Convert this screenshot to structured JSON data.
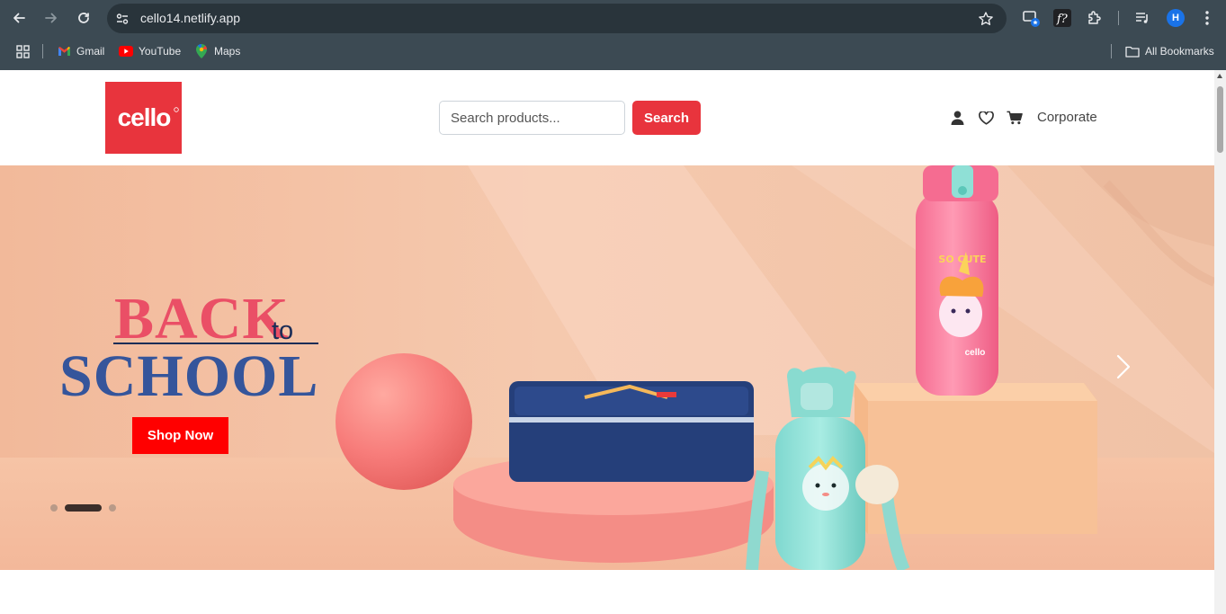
{
  "browser": {
    "url": "cello14.netlify.app",
    "bookmarks": [
      {
        "label": "Gmail",
        "icon": "gmail-icon"
      },
      {
        "label": "YouTube",
        "icon": "youtube-icon"
      },
      {
        "label": "Maps",
        "icon": "maps-icon"
      }
    ],
    "all_bookmarks_label": "All Bookmarks",
    "profile_initial": "H"
  },
  "header": {
    "logo_text": "cello",
    "search": {
      "placeholder": "Search products...",
      "value": "",
      "button_label": "Search"
    },
    "icons": [
      "user-icon",
      "heart-icon",
      "cart-icon"
    ],
    "corporate_label": "Corporate"
  },
  "hero": {
    "headline_line1": "BACK",
    "headline_to": "to",
    "headline_line2": "SCHOOL",
    "cta_label": "Shop Now",
    "bottle_text": "SO CUTE",
    "bottle_brand": "cello",
    "slides_count": 3,
    "active_slide": 2
  },
  "colors": {
    "brand_red": "#e8343d",
    "cta_red": "#ff0000",
    "chrome_bg": "#3c4a53",
    "hero_bg": "#f3c2a5"
  }
}
